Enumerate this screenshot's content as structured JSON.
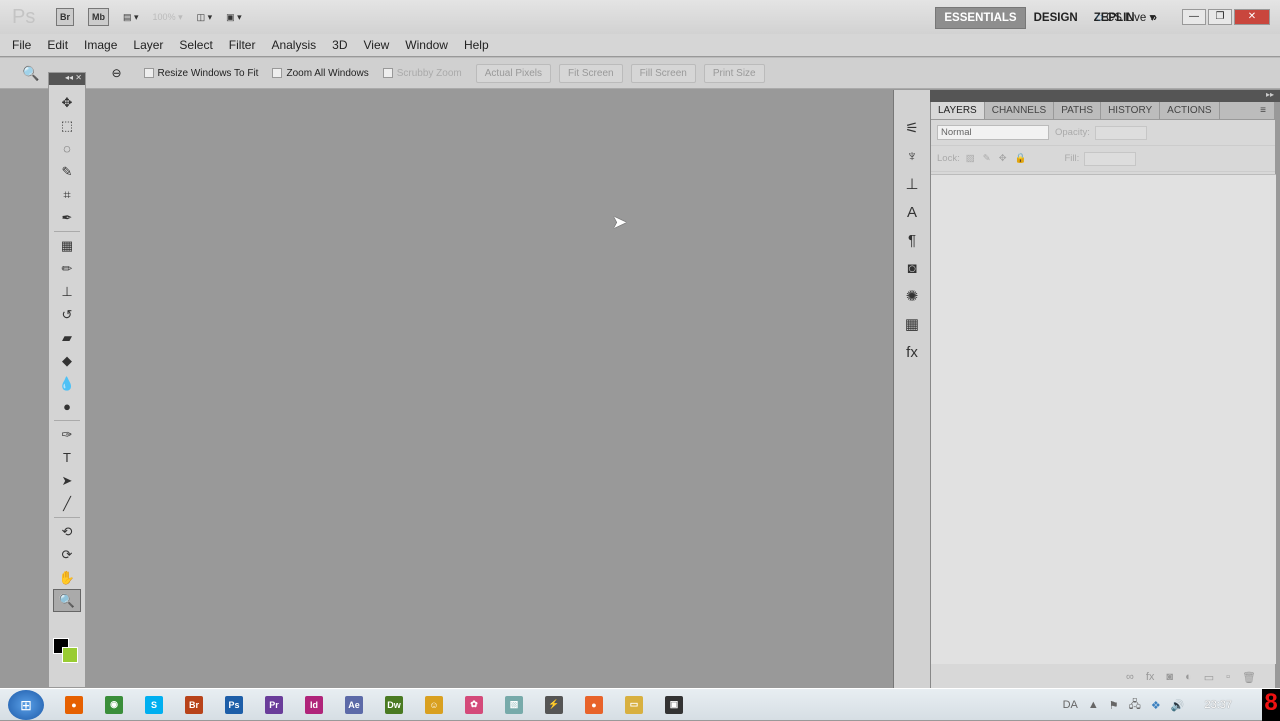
{
  "app": {
    "logo": "Ps",
    "bridge": "Br",
    "minibridge": "Mb",
    "zoom": "100%"
  },
  "workspaces": [
    "ESSENTIALS",
    "DESIGN",
    "ZEPLIN"
  ],
  "more": "»",
  "cslive": "CS Live ▾",
  "window_buttons": [
    "—",
    "❐",
    "✕"
  ],
  "menu": [
    "File",
    "Edit",
    "Image",
    "Layer",
    "Select",
    "Filter",
    "Analysis",
    "3D",
    "View",
    "Window",
    "Help"
  ],
  "options": {
    "resize": "Resize Windows To Fit",
    "zoom_all": "Zoom All Windows",
    "scrubby": "Scrubby Zoom",
    "actual": "Actual Pixels",
    "fit": "Fit Screen",
    "fill": "Fill Screen",
    "print": "Print Size"
  },
  "tools": [
    {
      "name": "move-tool-icon",
      "g": "✥"
    },
    {
      "name": "marquee-tool-icon",
      "g": "⬚"
    },
    {
      "name": "lasso-tool-icon",
      "g": "◌"
    },
    {
      "name": "quick-selection-icon",
      "g": "✎"
    },
    {
      "name": "crop-tool-icon",
      "g": "⌗"
    },
    {
      "name": "eyedropper-icon",
      "g": "✒"
    },
    {
      "sep": true
    },
    {
      "name": "healing-brush-icon",
      "g": "▦"
    },
    {
      "name": "brush-tool-icon",
      "g": "✏"
    },
    {
      "name": "clone-stamp-icon",
      "g": "⊥"
    },
    {
      "name": "history-brush-icon",
      "g": "↺"
    },
    {
      "name": "eraser-icon",
      "g": "▰"
    },
    {
      "name": "paint-bucket-icon",
      "g": "◆"
    },
    {
      "name": "blur-tool-icon",
      "g": "💧"
    },
    {
      "name": "dodge-tool-icon",
      "g": "●"
    },
    {
      "sep": true
    },
    {
      "name": "pen-tool-icon",
      "g": "✑"
    },
    {
      "name": "type-tool-icon",
      "g": "T"
    },
    {
      "name": "path-selection-icon",
      "g": "➤"
    },
    {
      "name": "line-tool-icon",
      "g": "╱"
    },
    {
      "sep": true
    },
    {
      "name": "3d-rotate-icon",
      "g": "⟲"
    },
    {
      "name": "3d-orbit-icon",
      "g": "⟳"
    },
    {
      "name": "hand-tool-icon",
      "g": "✋"
    },
    {
      "name": "zoom-tool-icon",
      "g": "🔍",
      "sel": true
    }
  ],
  "dock_icons": [
    {
      "name": "adjust-icon",
      "g": "⚟"
    },
    {
      "name": "brushes-icon",
      "g": "♆"
    },
    {
      "name": "clone-source-icon",
      "g": "⊥"
    },
    {
      "name": "character-icon",
      "g": "A"
    },
    {
      "name": "paragraph-icon",
      "g": "¶"
    },
    {
      "name": "masks-icon",
      "g": "◙"
    },
    {
      "name": "styles-icon",
      "g": "✺"
    },
    {
      "name": "swatches-icon",
      "g": "▦"
    },
    {
      "name": "fx-icon",
      "g": "fx"
    }
  ],
  "layers_panel": {
    "tabs": [
      "LAYERS",
      "CHANNELS",
      "PATHS",
      "HISTORY",
      "ACTIONS"
    ],
    "blend_mode": "Normal",
    "opacity_label": "Opacity:",
    "lock_label": "Lock:",
    "fill_label": "Fill:"
  },
  "taskbar": {
    "apps": [
      {
        "name": "firefox",
        "g": "●",
        "c": "#e66000"
      },
      {
        "name": "chrome",
        "g": "◉",
        "c": "#3a8e3a"
      },
      {
        "name": "skype",
        "g": "S",
        "c": "#00aff0"
      },
      {
        "name": "bridge",
        "g": "Br",
        "c": "#b8431a"
      },
      {
        "name": "photoshop",
        "g": "Ps",
        "c": "#1d5ea8"
      },
      {
        "name": "premiere",
        "g": "Pr",
        "c": "#6a3d9a"
      },
      {
        "name": "indesign",
        "g": "Id",
        "c": "#b0247a"
      },
      {
        "name": "after-effects",
        "g": "Ae",
        "c": "#5c6aa8"
      },
      {
        "name": "dreamweaver",
        "g": "Dw",
        "c": "#4a7a22"
      },
      {
        "name": "messenger",
        "g": "☺",
        "c": "#d9a020"
      },
      {
        "name": "app-pink",
        "g": "✿",
        "c": "#d44a7a"
      },
      {
        "name": "app-image",
        "g": "▧",
        "c": "#7aa"
      },
      {
        "name": "app-tool",
        "g": "⚡",
        "c": "#555"
      },
      {
        "name": "app-orange",
        "g": "●",
        "c": "#e8632a"
      },
      {
        "name": "explorer",
        "g": "▭",
        "c": "#d8b040"
      },
      {
        "name": "app-console",
        "g": "▣",
        "c": "#333"
      }
    ],
    "lang": "DA",
    "clock": "23:37"
  }
}
